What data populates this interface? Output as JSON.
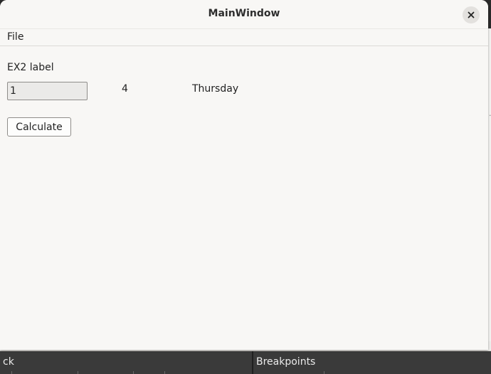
{
  "window": {
    "title": "MainWindow"
  },
  "menubar": {
    "items": [
      {
        "label": "File"
      }
    ]
  },
  "form": {
    "label": "EX2 label",
    "input_value": "1",
    "result_number": "4",
    "result_day": "Thursday",
    "calculate_label": "Calculate"
  },
  "background": {
    "bottom_left_label": "ck",
    "bottom_right_label": "Breakpoints"
  },
  "icons": {
    "close": "close-icon"
  }
}
